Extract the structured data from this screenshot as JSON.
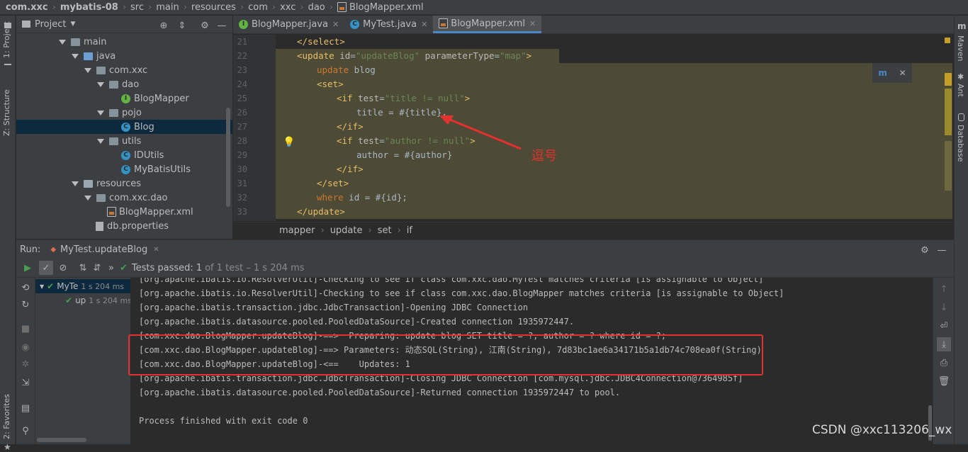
{
  "breadcrumb": {
    "items": [
      "com.xxc",
      "mybatis-08",
      "src",
      "main",
      "resources",
      "com",
      "xxc",
      "dao",
      "BlogMapper.xml"
    ]
  },
  "left_strip": {
    "project": "1: Project",
    "structure": "Z: Structure",
    "favorites": "2: Favorites"
  },
  "right_strip": {
    "maven": "Maven",
    "ant": "Ant",
    "database": "Database"
  },
  "project_panel": {
    "title": "Project",
    "tree": [
      {
        "label": "main",
        "indent": 60,
        "kind": "folder",
        "arrow": true
      },
      {
        "label": "java",
        "indent": 78,
        "kind": "folder-blue",
        "arrow": true
      },
      {
        "label": "com.xxc",
        "indent": 96,
        "kind": "folder",
        "arrow": true
      },
      {
        "label": "dao",
        "indent": 114,
        "kind": "folder",
        "arrow": true
      },
      {
        "label": "BlogMapper",
        "indent": 148,
        "kind": "interface",
        "arrow": false
      },
      {
        "label": "pojo",
        "indent": 114,
        "kind": "folder",
        "arrow": true
      },
      {
        "label": "Blog",
        "indent": 148,
        "kind": "class",
        "arrow": false,
        "selected": true
      },
      {
        "label": "utils",
        "indent": 114,
        "kind": "folder",
        "arrow": true
      },
      {
        "label": "IDUtils",
        "indent": 148,
        "kind": "class",
        "arrow": false
      },
      {
        "label": "MyBatisUtils",
        "indent": 148,
        "kind": "class",
        "arrow": false
      },
      {
        "label": "resources",
        "indent": 78,
        "kind": "folder-res",
        "arrow": true
      },
      {
        "label": "com.xxc.dao",
        "indent": 96,
        "kind": "folder",
        "arrow": true
      },
      {
        "label": "BlogMapper.xml",
        "indent": 128,
        "kind": "xml",
        "arrow": false
      },
      {
        "label": "db.properties",
        "indent": 112,
        "kind": "file",
        "arrow": false
      }
    ]
  },
  "editor_tabs": [
    {
      "label": "BlogMapper.java",
      "icon": "I",
      "active": false
    },
    {
      "label": "MyTest.java",
      "icon": "C",
      "active": false
    },
    {
      "label": "BlogMapper.xml",
      "icon": "xml",
      "active": true
    }
  ],
  "code": {
    "line_numbers": [
      "21",
      "22",
      "23",
      "24",
      "25",
      "26",
      "27",
      "28",
      "29",
      "30",
      "31",
      "32",
      "33"
    ],
    "lines": [
      "</select>",
      "<update id=\"updateBlog\" parameterType=\"map\">",
      "update blog",
      "<set>",
      "<if test=\"title != null\">",
      "title = #{title},",
      "</if>",
      "<if test=\"author != null\">",
      "author = #{author}",
      "</if>",
      "</set>",
      "where id = #{id};",
      "</update>"
    ]
  },
  "annotation": {
    "text": "逗号"
  },
  "editor_breadcrumb": [
    "mapper",
    "update",
    "set",
    "if"
  ],
  "run": {
    "label": "Run:",
    "config": "MyTest.updateBlog",
    "tests_passed": "Tests passed:",
    "tests_count": "1",
    "tests_rest": "of 1 test – 1 s 204 ms",
    "tree": [
      {
        "name": "MyTe",
        "time": "1 s 204 ms"
      },
      {
        "name": "up",
        "time": "1 s 204 ms"
      }
    ]
  },
  "console": {
    "lines": [
      "[org.apache.ibatis.io.ResolverUtil]-Checking to see if class com.xxc.dao.MyTest matches criteria [is assignable to Object]",
      "[org.apache.ibatis.io.ResolverUtil]-Checking to see if class com.xxc.dao.BlogMapper matches criteria [is assignable to Object]",
      "[org.apache.ibatis.transaction.jdbc.JdbcTransaction]-Opening JDBC Connection",
      "[org.apache.ibatis.datasource.pooled.PooledDataSource]-Created connection 1935972447.",
      "[com.xxc.dao.BlogMapper.updateBlog]-==>  Preparing: update blog SET title = ?, author = ? where id = ?;",
      "[com.xxc.dao.BlogMapper.updateBlog]-==> Parameters: 动态SQL(String), 江南(String), 7d83bc1ae6a34171b5a1db74c708ea0f(String)",
      "[com.xxc.dao.BlogMapper.updateBlog]-<==    Updates: 1",
      "[org.apache.ibatis.transaction.jdbc.JdbcTransaction]-Closing JDBC Connection [com.mysql.jdbc.JDBC4Connection@7364985f]",
      "[org.apache.ibatis.datasource.pooled.PooledDataSource]-Returned connection 1935972447 to pool.",
      "",
      "Process finished with exit code 0"
    ]
  },
  "watermark": "CSDN @xxc113206_wx"
}
